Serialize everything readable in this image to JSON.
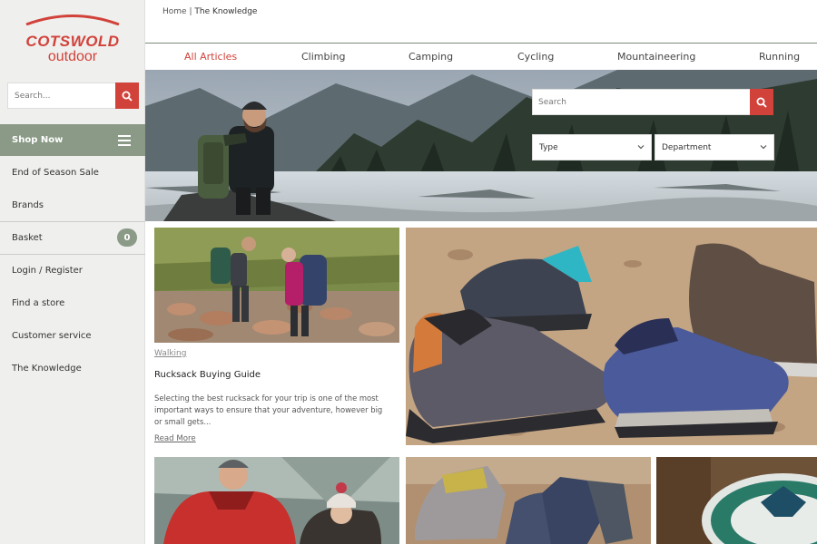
{
  "brand": {
    "name_line1": "COTSWOLD",
    "name_line2": "outdoor",
    "color": "#d1423a"
  },
  "sidebar": {
    "search_placeholder": "Search...",
    "shop_now_label": "Shop Now",
    "items": [
      {
        "label": "End of Season Sale"
      },
      {
        "label": "Brands"
      },
      {
        "label": "Basket",
        "badge": "0"
      },
      {
        "label": "Login / Register"
      },
      {
        "label": "Find a store"
      },
      {
        "label": "Customer service"
      },
      {
        "label": "The Knowledge"
      }
    ]
  },
  "breadcrumb": {
    "home": "Home",
    "separator": "|",
    "current": "The Knowledge"
  },
  "tabs": [
    {
      "label": "All Articles",
      "active": true
    },
    {
      "label": "Climbing"
    },
    {
      "label": "Camping"
    },
    {
      "label": "Cycling"
    },
    {
      "label": "Mountaineering"
    },
    {
      "label": "Running"
    }
  ],
  "hero": {
    "search_placeholder": "Search",
    "type_select": "Type",
    "department_select": "Department"
  },
  "articles": [
    {
      "category": "Walking",
      "title": "Rucksack Buying Guide",
      "excerpt": "Selecting the best rucksack for your trip is one of the most important ways to ensure that your adventure, however big or small gets...",
      "read_more": "Read More"
    }
  ],
  "colors": {
    "accent": "#d1423a",
    "sidebar_green": "#8a9a87"
  }
}
